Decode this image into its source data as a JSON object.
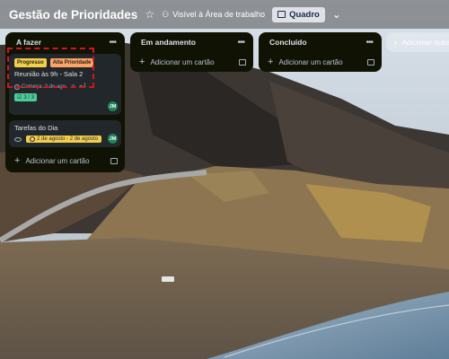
{
  "board": {
    "title": "Gestão de Prioridades",
    "visibility": "Visível à Área de trabalho",
    "view": "Quadro"
  },
  "icons": {
    "star": "star-icon",
    "visibility": "people-icon",
    "view": "board-icon",
    "chevron": "chevron-down-icon"
  },
  "lists": [
    {
      "title": "A fazer",
      "add_card": "Adicionar um cartão",
      "cards": [
        {
          "labels": [
            {
              "text": "Progresso",
              "color": "#f5cd47"
            },
            {
              "text": "Alta Prioridade",
              "color": "#fea362"
            }
          ],
          "title": "Reunião às 9h - Sala 2",
          "date": "Começa: 2 de ago.",
          "attachments": "1",
          "checklist": "3 / 3",
          "member": "JM"
        },
        {
          "title": "Tarefas do Dia",
          "date": "2 de agosto - 2 de agosto",
          "member": "JM"
        }
      ]
    },
    {
      "title": "Em andamento",
      "add_card": "Adicionar um cartão"
    },
    {
      "title": "Concluído",
      "add_card": "Adicionar um cartão"
    }
  ],
  "add_list": "Adicionar outra lista"
}
